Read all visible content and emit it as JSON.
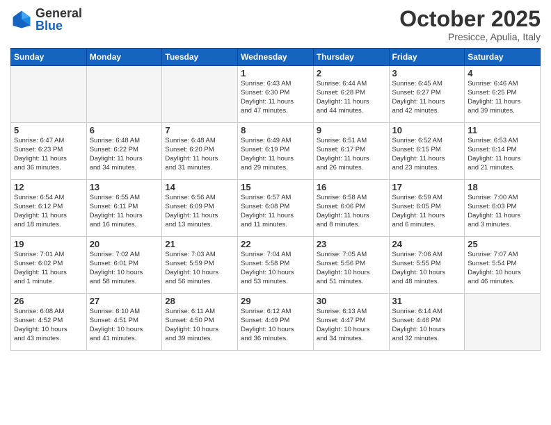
{
  "logo": {
    "general": "General",
    "blue": "Blue"
  },
  "title": "October 2025",
  "subtitle": "Presicce, Apulia, Italy",
  "weekdays": [
    "Sunday",
    "Monday",
    "Tuesday",
    "Wednesday",
    "Thursday",
    "Friday",
    "Saturday"
  ],
  "weeks": [
    [
      {
        "day": "",
        "info": "",
        "empty": true
      },
      {
        "day": "",
        "info": "",
        "empty": true
      },
      {
        "day": "",
        "info": "",
        "empty": true
      },
      {
        "day": "1",
        "info": "Sunrise: 6:43 AM\nSunset: 6:30 PM\nDaylight: 11 hours\nand 47 minutes.",
        "empty": false
      },
      {
        "day": "2",
        "info": "Sunrise: 6:44 AM\nSunset: 6:28 PM\nDaylight: 11 hours\nand 44 minutes.",
        "empty": false
      },
      {
        "day": "3",
        "info": "Sunrise: 6:45 AM\nSunset: 6:27 PM\nDaylight: 11 hours\nand 42 minutes.",
        "empty": false
      },
      {
        "day": "4",
        "info": "Sunrise: 6:46 AM\nSunset: 6:25 PM\nDaylight: 11 hours\nand 39 minutes.",
        "empty": false
      }
    ],
    [
      {
        "day": "5",
        "info": "Sunrise: 6:47 AM\nSunset: 6:23 PM\nDaylight: 11 hours\nand 36 minutes.",
        "empty": false
      },
      {
        "day": "6",
        "info": "Sunrise: 6:48 AM\nSunset: 6:22 PM\nDaylight: 11 hours\nand 34 minutes.",
        "empty": false
      },
      {
        "day": "7",
        "info": "Sunrise: 6:48 AM\nSunset: 6:20 PM\nDaylight: 11 hours\nand 31 minutes.",
        "empty": false
      },
      {
        "day": "8",
        "info": "Sunrise: 6:49 AM\nSunset: 6:19 PM\nDaylight: 11 hours\nand 29 minutes.",
        "empty": false
      },
      {
        "day": "9",
        "info": "Sunrise: 6:51 AM\nSunset: 6:17 PM\nDaylight: 11 hours\nand 26 minutes.",
        "empty": false
      },
      {
        "day": "10",
        "info": "Sunrise: 6:52 AM\nSunset: 6:15 PM\nDaylight: 11 hours\nand 23 minutes.",
        "empty": false
      },
      {
        "day": "11",
        "info": "Sunrise: 6:53 AM\nSunset: 6:14 PM\nDaylight: 11 hours\nand 21 minutes.",
        "empty": false
      }
    ],
    [
      {
        "day": "12",
        "info": "Sunrise: 6:54 AM\nSunset: 6:12 PM\nDaylight: 11 hours\nand 18 minutes.",
        "empty": false
      },
      {
        "day": "13",
        "info": "Sunrise: 6:55 AM\nSunset: 6:11 PM\nDaylight: 11 hours\nand 16 minutes.",
        "empty": false
      },
      {
        "day": "14",
        "info": "Sunrise: 6:56 AM\nSunset: 6:09 PM\nDaylight: 11 hours\nand 13 minutes.",
        "empty": false
      },
      {
        "day": "15",
        "info": "Sunrise: 6:57 AM\nSunset: 6:08 PM\nDaylight: 11 hours\nand 11 minutes.",
        "empty": false
      },
      {
        "day": "16",
        "info": "Sunrise: 6:58 AM\nSunset: 6:06 PM\nDaylight: 11 hours\nand 8 minutes.",
        "empty": false
      },
      {
        "day": "17",
        "info": "Sunrise: 6:59 AM\nSunset: 6:05 PM\nDaylight: 11 hours\nand 6 minutes.",
        "empty": false
      },
      {
        "day": "18",
        "info": "Sunrise: 7:00 AM\nSunset: 6:03 PM\nDaylight: 11 hours\nand 3 minutes.",
        "empty": false
      }
    ],
    [
      {
        "day": "19",
        "info": "Sunrise: 7:01 AM\nSunset: 6:02 PM\nDaylight: 11 hours\nand 1 minute.",
        "empty": false
      },
      {
        "day": "20",
        "info": "Sunrise: 7:02 AM\nSunset: 6:01 PM\nDaylight: 10 hours\nand 58 minutes.",
        "empty": false
      },
      {
        "day": "21",
        "info": "Sunrise: 7:03 AM\nSunset: 5:59 PM\nDaylight: 10 hours\nand 56 minutes.",
        "empty": false
      },
      {
        "day": "22",
        "info": "Sunrise: 7:04 AM\nSunset: 5:58 PM\nDaylight: 10 hours\nand 53 minutes.",
        "empty": false
      },
      {
        "day": "23",
        "info": "Sunrise: 7:05 AM\nSunset: 5:56 PM\nDaylight: 10 hours\nand 51 minutes.",
        "empty": false
      },
      {
        "day": "24",
        "info": "Sunrise: 7:06 AM\nSunset: 5:55 PM\nDaylight: 10 hours\nand 48 minutes.",
        "empty": false
      },
      {
        "day": "25",
        "info": "Sunrise: 7:07 AM\nSunset: 5:54 PM\nDaylight: 10 hours\nand 46 minutes.",
        "empty": false
      }
    ],
    [
      {
        "day": "26",
        "info": "Sunrise: 6:08 AM\nSunset: 4:52 PM\nDaylight: 10 hours\nand 43 minutes.",
        "empty": false
      },
      {
        "day": "27",
        "info": "Sunrise: 6:10 AM\nSunset: 4:51 PM\nDaylight: 10 hours\nand 41 minutes.",
        "empty": false
      },
      {
        "day": "28",
        "info": "Sunrise: 6:11 AM\nSunset: 4:50 PM\nDaylight: 10 hours\nand 39 minutes.",
        "empty": false
      },
      {
        "day": "29",
        "info": "Sunrise: 6:12 AM\nSunset: 4:49 PM\nDaylight: 10 hours\nand 36 minutes.",
        "empty": false
      },
      {
        "day": "30",
        "info": "Sunrise: 6:13 AM\nSunset: 4:47 PM\nDaylight: 10 hours\nand 34 minutes.",
        "empty": false
      },
      {
        "day": "31",
        "info": "Sunrise: 6:14 AM\nSunset: 4:46 PM\nDaylight: 10 hours\nand 32 minutes.",
        "empty": false
      },
      {
        "day": "",
        "info": "",
        "empty": true
      }
    ]
  ]
}
